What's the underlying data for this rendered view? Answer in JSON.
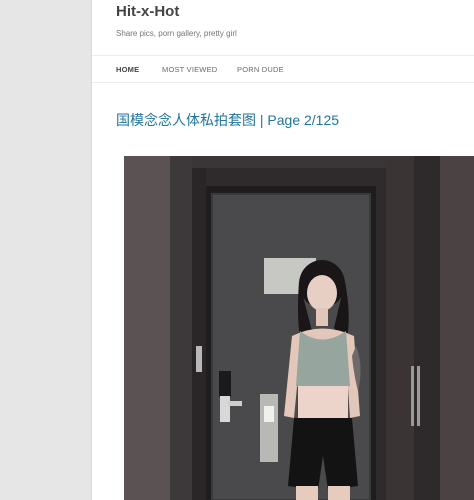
{
  "site": {
    "title": "Hit-x-Hot",
    "tagline": "Share pics, porn gallery, pretty girl"
  },
  "nav": {
    "items": [
      {
        "label": "HOME",
        "active": true
      },
      {
        "label": "MOST VIEWED",
        "active": false
      },
      {
        "label": "PORN DUDE",
        "active": false
      }
    ]
  },
  "post": {
    "title": "国模念念人体私拍套图 | Page 2/125"
  },
  "colors": {
    "link": "#21759b",
    "background": "#e6e6e6"
  }
}
